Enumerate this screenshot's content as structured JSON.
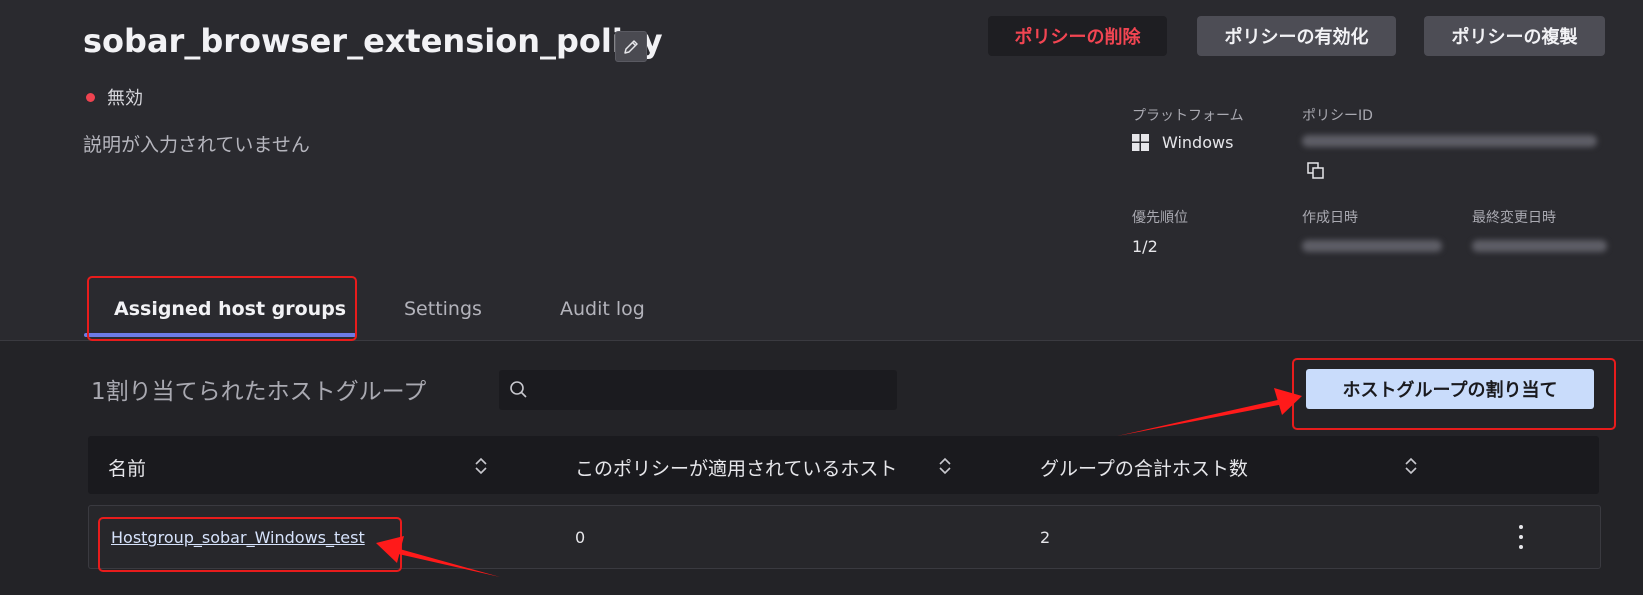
{
  "policy": {
    "title": "sobar_browser_extension_policy",
    "status": "無効",
    "description": "説明が入力されていません"
  },
  "actions": {
    "delete_label": "ポリシーの削除",
    "enable_label": "ポリシーの有効化",
    "duplicate_label": "ポリシーの複製"
  },
  "meta": {
    "platform_label": "プラットフォーム",
    "platform_value": "Windows",
    "policy_id_label": "ポリシーID",
    "priority_label": "優先順位",
    "priority_value": "1/2",
    "created_label": "作成日時",
    "modified_label": "最終変更日時"
  },
  "tabs": [
    {
      "label": "Assigned host groups",
      "active": true
    },
    {
      "label": "Settings",
      "active": false
    },
    {
      "label": "Audit log",
      "active": false
    }
  ],
  "groups": {
    "count_title": "1割り当てられたホストグループ",
    "search_placeholder": "",
    "assign_button": "ホストグループの割り当て"
  },
  "table": {
    "columns": [
      "名前",
      "このポリシーが適用されているホスト",
      "グループの合計ホスト数"
    ],
    "rows": [
      {
        "name": "Hostgroup_sobar_Windows_test",
        "applied_hosts": "0",
        "total_hosts": "2"
      }
    ]
  },
  "colors": {
    "accent_tab": "#6d7be6",
    "delete_text": "#f24552",
    "annotation_red": "#e81c1c",
    "assign_button_bg": "#c9dcfb"
  }
}
